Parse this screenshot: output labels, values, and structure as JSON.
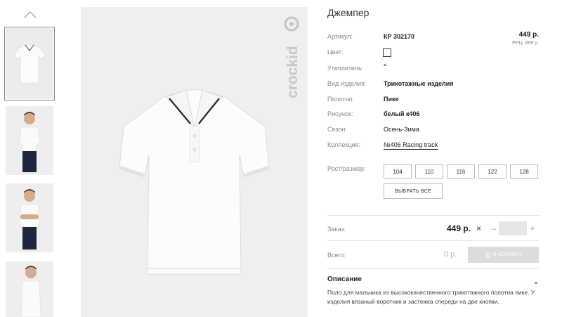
{
  "product": {
    "title": "Джемпер",
    "price": "449 р.",
    "rrp": "РРЦ: 899 р."
  },
  "attributes": [
    {
      "label": "Артикул:",
      "value": "КР 302170"
    },
    {
      "label": "Цвет:",
      "value": ""
    },
    {
      "label": "Утеплитель:",
      "value": "\""
    },
    {
      "label": "Вид изделия:",
      "value": "Трикотажные изделия"
    },
    {
      "label": "Полотно:",
      "value": "Пике"
    },
    {
      "label": "Рисунок:",
      "value": "белый к406"
    },
    {
      "label": "Сезон:",
      "value": "Осень-Зима"
    },
    {
      "label": "Коллекция:",
      "value": "№406 Racing track"
    }
  ],
  "sizes": {
    "label": "Рост/размер:",
    "options": [
      "104",
      "110",
      "116",
      "122",
      "128"
    ],
    "select_all": "ВЫБРАТЬ ВСЕ"
  },
  "order": {
    "label": "Заказ:",
    "price": "449 р.",
    "times": "×",
    "minus": "–",
    "plus": "+",
    "quantity": ""
  },
  "total": {
    "label": "Всего:",
    "value": "0 р.",
    "cart_button": "В КОРЗИНУ"
  },
  "description": {
    "title": "Описание",
    "text": "Поло для мальчика из высококачественного трикотажного полотна пике. У изделия вязаный воротник и застежка спереди на две кнопки."
  },
  "icons": {
    "thumb_up": "chevron-up-icon",
    "cart": "cart-icon",
    "caret": "chevron-up-icon"
  },
  "colors": {
    "accent_gray": "#dcdcdc",
    "text": "#333333",
    "muted": "#888888"
  },
  "brand": {
    "watermark": "crockid"
  }
}
